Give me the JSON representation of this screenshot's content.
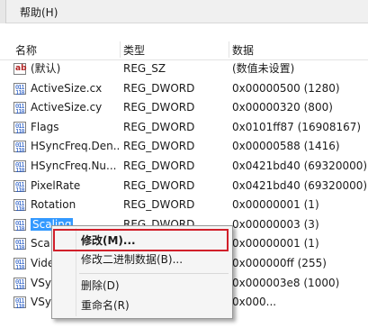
{
  "menu": {
    "help": "帮助(H)"
  },
  "columns": {
    "name": "名称",
    "type": "类型",
    "data": "数据"
  },
  "rows": [
    {
      "icon": "string-value-icon",
      "name": "(默认)",
      "type": "REG_SZ",
      "data": "(数值未设置)"
    },
    {
      "icon": "binary-value-icon",
      "name": "ActiveSize.cx",
      "type": "REG_DWORD",
      "data": "0x00000500 (1280)"
    },
    {
      "icon": "binary-value-icon",
      "name": "ActiveSize.cy",
      "type": "REG_DWORD",
      "data": "0x00000320 (800)"
    },
    {
      "icon": "binary-value-icon",
      "name": "Flags",
      "type": "REG_DWORD",
      "data": "0x0101ff87 (16908167)"
    },
    {
      "icon": "binary-value-icon",
      "name": "HSyncFreq.Den...",
      "type": "REG_DWORD",
      "data": "0x00000588 (1416)"
    },
    {
      "icon": "binary-value-icon",
      "name": "HSyncFreq.Nu...",
      "type": "REG_DWORD",
      "data": "0x0421bd40 (69320000)"
    },
    {
      "icon": "binary-value-icon",
      "name": "PixelRate",
      "type": "REG_DWORD",
      "data": "0x0421bd40 (69320000)"
    },
    {
      "icon": "binary-value-icon",
      "name": "Rotation",
      "type": "REG_DWORD",
      "data": "0x00000001 (1)"
    },
    {
      "icon": "binary-value-icon",
      "name": "Scaling",
      "type": "REG_DWORD",
      "data": "0x00000003 (3)",
      "selected": true
    },
    {
      "icon": "binary-value-icon",
      "name": "Sca",
      "type": "",
      "data": "0x00000001 (1)"
    },
    {
      "icon": "binary-value-icon",
      "name": "Vide",
      "type": "",
      "data": "0x000000ff (255)"
    },
    {
      "icon": "binary-value-icon",
      "name": "VSy",
      "type": "",
      "data": "0x000003e8 (1000)"
    },
    {
      "icon": "binary-value-icon",
      "name": "VSy",
      "type": "",
      "data": "0x000..."
    }
  ],
  "context_menu": {
    "modify": "修改(M)...",
    "modify_binary": "修改二进制数据(B)...",
    "delete": "删除(D)",
    "rename": "重命名(R)"
  },
  "colors": {
    "selection": "#3399ff",
    "highlight_box": "#d11f2a"
  }
}
